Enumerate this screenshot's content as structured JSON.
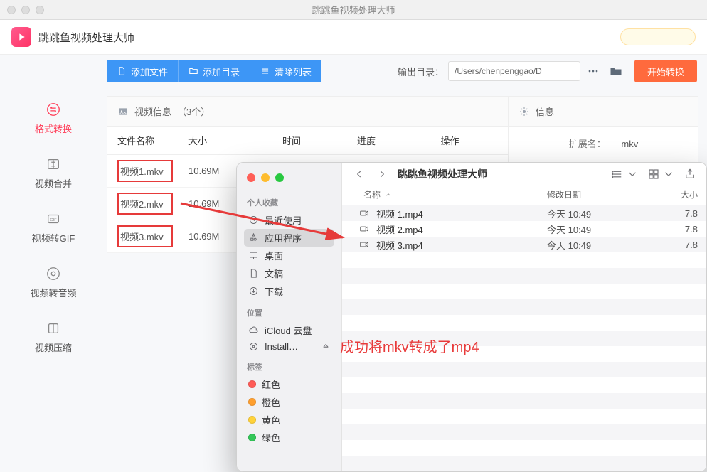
{
  "window": {
    "title": "跳跳鱼视频处理大师"
  },
  "header": {
    "app_name": "跳跳鱼视频处理大师"
  },
  "sidebar": {
    "items": [
      {
        "label": "格式转换"
      },
      {
        "label": "视频合并"
      },
      {
        "label": "视频转GIF"
      },
      {
        "label": "视频转音频"
      },
      {
        "label": "视频压缩"
      }
    ]
  },
  "toolbar": {
    "add_file": "添加文件",
    "add_dir": "添加目录",
    "clear": "清除列表",
    "output_label": "输出目录：",
    "output_path": "/Users/chenpenggao/D",
    "start": "开始转换"
  },
  "video_panel": {
    "title_prefix": "视频信息",
    "count": "（3个）",
    "columns": {
      "name": "文件名称",
      "size": "大小",
      "time": "时间",
      "progress": "进度",
      "op": "操作"
    },
    "rows": [
      {
        "name": "视频1.mkv",
        "size": "10.69M"
      },
      {
        "name": "视频2.mkv",
        "size": "10.69M"
      },
      {
        "name": "视频3.mkv",
        "size": "10.69M"
      }
    ]
  },
  "info_panel": {
    "title": "信息",
    "ext_label": "扩展名：",
    "ext_value": "mkv"
  },
  "finder": {
    "title": "跳跳鱼视频处理大师",
    "side_sections": {
      "fav": "个人收藏",
      "loc": "位置",
      "tag": "标签"
    },
    "fav_items": [
      {
        "label": "最近使用"
      },
      {
        "label": "应用程序"
      },
      {
        "label": "桌面"
      },
      {
        "label": "文稿"
      },
      {
        "label": "下载"
      }
    ],
    "loc_items": [
      {
        "label": "iCloud 云盘"
      },
      {
        "label": "Install…"
      }
    ],
    "tags": [
      {
        "label": "红色",
        "color": "#ff5b57"
      },
      {
        "label": "橙色",
        "color": "#ff9f2e"
      },
      {
        "label": "黄色",
        "color": "#ffd23a"
      },
      {
        "label": "绿色",
        "color": "#34c759"
      }
    ],
    "columns": {
      "name": "名称",
      "date": "修改日期",
      "size": "大小"
    },
    "rows": [
      {
        "name": "视频 1.mp4",
        "date": "今天 10:49",
        "size": "7.8"
      },
      {
        "name": "视频 2.mp4",
        "date": "今天 10:49",
        "size": "7.8"
      },
      {
        "name": "视频 3.mp4",
        "date": "今天 10:49",
        "size": "7.8"
      }
    ]
  },
  "annotation": "成功将mkv转成了mp4"
}
